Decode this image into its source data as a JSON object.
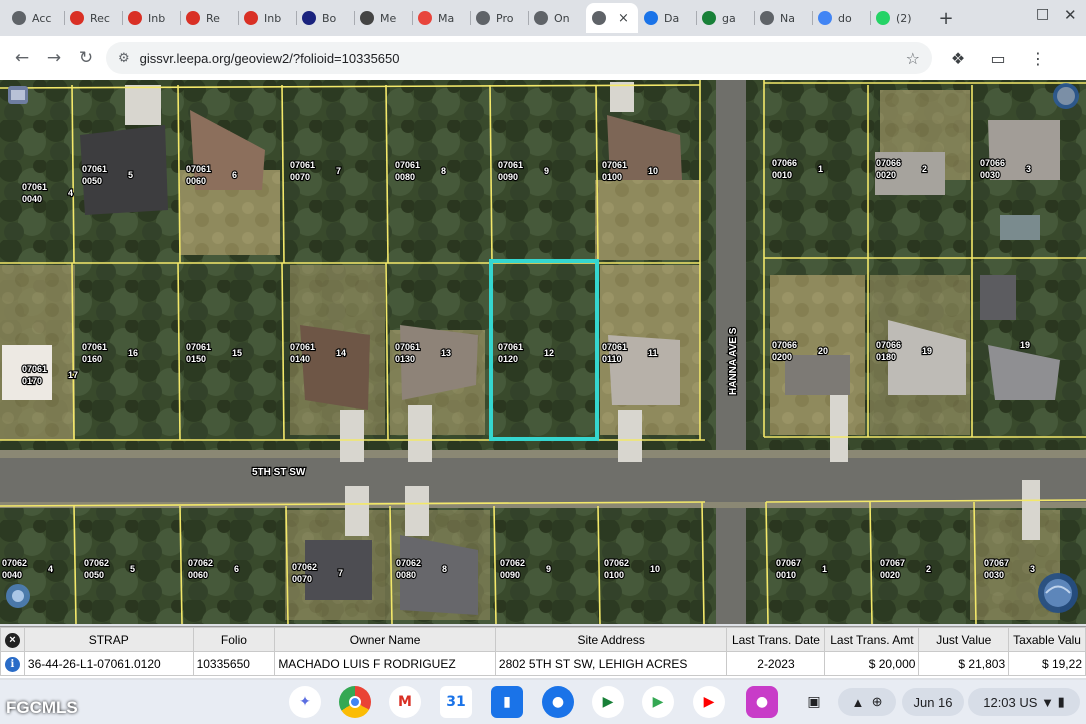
{
  "browser": {
    "tabs": [
      {
        "label": "Acc",
        "icon": "globe-icon",
        "color": "#5f6368"
      },
      {
        "label": "Rec",
        "icon": "gmail-icon",
        "color": "#d93025"
      },
      {
        "label": "Inb",
        "icon": "gmail-icon",
        "color": "#d93025"
      },
      {
        "label": "Re",
        "icon": "gmail-icon",
        "color": "#d93025"
      },
      {
        "label": "Inb",
        "icon": "gmail-icon",
        "color": "#d93025"
      },
      {
        "label": "Bo",
        "icon": "bolt-icon",
        "color": "#1a237e"
      },
      {
        "label": "Me",
        "icon": "openai-icon",
        "color": "#444444"
      },
      {
        "label": "Ma",
        "icon": "target-icon",
        "color": "#e8453c"
      },
      {
        "label": "Pro",
        "icon": "globe-icon",
        "color": "#5f6368"
      },
      {
        "label": "On",
        "icon": "globe-icon",
        "color": "#5f6368"
      },
      {
        "label": "",
        "icon": "globe-icon",
        "color": "#5f6368",
        "active": true
      },
      {
        "label": "Da",
        "icon": "gear-icon",
        "color": "#1a73e8"
      },
      {
        "label": "ga",
        "icon": "sheets-icon",
        "color": "#188038"
      },
      {
        "label": "Na",
        "icon": "globe-icon",
        "color": "#5f6368"
      },
      {
        "label": "do",
        "icon": "smile-icon",
        "color": "#4285f4"
      },
      {
        "label": "(2)",
        "icon": "whatsapp-icon",
        "color": "#25d366"
      }
    ],
    "new_tab_label": "+",
    "url": "gissvr.leepa.org/geoview2/?folioid=10335650"
  },
  "map": {
    "street_horizontal": "5TH ST SW",
    "street_vertical": "HANNA AVE S",
    "parcels": [
      {
        "id": "07061\n0040",
        "lot": "4"
      },
      {
        "id": "07061\n0050",
        "lot": "5"
      },
      {
        "id": "07061\n0060",
        "lot": "6"
      },
      {
        "id": "07061\n0070",
        "lot": "7"
      },
      {
        "id": "07061\n0080",
        "lot": "8"
      },
      {
        "id": "07061\n0090",
        "lot": "9"
      },
      {
        "id": "07061\n0100",
        "lot": "10"
      },
      {
        "id": "07066\n0010",
        "lot": "1"
      },
      {
        "id": "07066\n0020",
        "lot": "2"
      },
      {
        "id": "07066\n0030",
        "lot": "3"
      },
      {
        "id": "07061\n0170",
        "lot": "17"
      },
      {
        "id": "07061\n0160",
        "lot": "16"
      },
      {
        "id": "07061\n0150",
        "lot": "15"
      },
      {
        "id": "07061\n0140",
        "lot": "14"
      },
      {
        "id": "07061\n0130",
        "lot": "13"
      },
      {
        "id": "07061\n0120",
        "lot": "12"
      },
      {
        "id": "07061\n0110",
        "lot": "11"
      },
      {
        "id": "07066\n0200",
        "lot": "20"
      },
      {
        "id": "07066\n0180",
        "lot": "19"
      },
      {
        "id": "",
        "lot": "19"
      },
      {
        "id": "07062\n0040",
        "lot": "4"
      },
      {
        "id": "07062\n0050",
        "lot": "5"
      },
      {
        "id": "07062\n0060",
        "lot": "6"
      },
      {
        "id": "07062\n0070",
        "lot": "7"
      },
      {
        "id": "07062\n0080",
        "lot": "8"
      },
      {
        "id": "07062\n0090",
        "lot": "9"
      },
      {
        "id": "07062\n0100",
        "lot": "10"
      },
      {
        "id": "07067\n0010",
        "lot": "1"
      },
      {
        "id": "07067\n0020",
        "lot": "2"
      },
      {
        "id": "07067\n0030",
        "lot": "3"
      }
    ],
    "selected_parcel": "07061 0120",
    "colors": {
      "parcel_line": "#f3e86a",
      "selection": "#35d6cf",
      "road": "#6f6f6a"
    }
  },
  "attributes": {
    "columns": [
      "STRAP",
      "Folio",
      "Owner Name",
      "Site Address",
      "Last Trans. Date",
      "Last Trans. Amt",
      "Just Value",
      "Taxable Valu"
    ],
    "row": [
      "36-44-26-L1-07061.0120",
      "10335650",
      "MACHADO LUIS F RODRIGUEZ",
      "2802 5TH ST SW, LEHIGH ACRES",
      "2-2023",
      "$ 20,000",
      "$ 21,803",
      "$ 19,22"
    ]
  },
  "shelf": {
    "watermark": "FGCMLS",
    "date": "Jun 16",
    "time": "12:03",
    "locale": "US"
  }
}
